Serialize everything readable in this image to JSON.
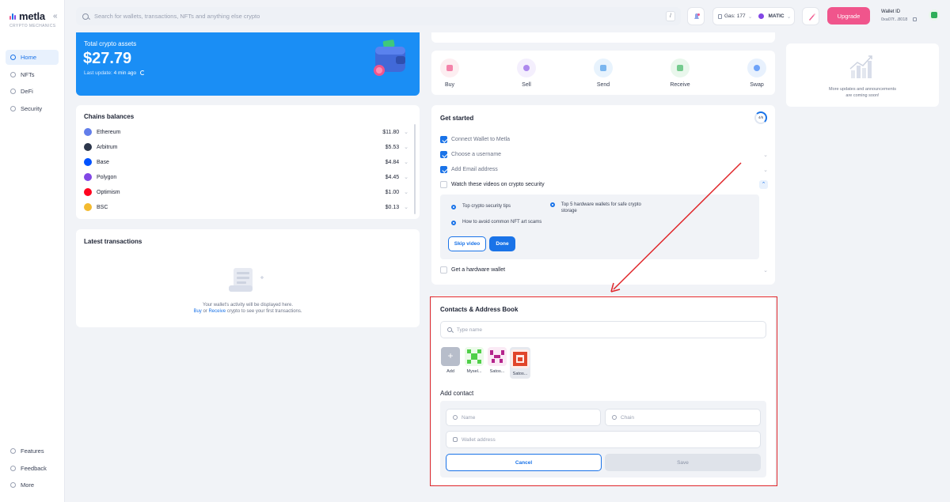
{
  "brand": {
    "name": "metla",
    "tagline": "CRYPTO MECHANICS",
    "collapse_glyph": "«"
  },
  "nav": {
    "items": [
      {
        "label": "Home",
        "active": true
      },
      {
        "label": "NFTs"
      },
      {
        "label": "DeFi"
      },
      {
        "label": "Security"
      }
    ],
    "bottom": [
      {
        "label": "Features"
      },
      {
        "label": "Feedback"
      },
      {
        "label": "More"
      }
    ]
  },
  "header": {
    "search_placeholder": "Search for wallets, transactions, NFTs and anything else crypto",
    "slash": "/",
    "gas_label": "Gas:",
    "gas_value": "177",
    "network": "MATIC",
    "upgrade": "Upgrade",
    "wallet_label": "Wallet ID",
    "wallet_value": "0xa07f...8018"
  },
  "assets": {
    "title": "Total crypto assets",
    "value": "$27.79",
    "update_label": "Last update:",
    "update_time": "4 min ago"
  },
  "chains": {
    "title": "Chains balances",
    "rows": [
      {
        "name": "Ethereum",
        "value": "$11.80",
        "color": "#627eea"
      },
      {
        "name": "Arbitrum",
        "value": "$5.53",
        "color": "#2d374b"
      },
      {
        "name": "Base",
        "value": "$4.84",
        "color": "#0052ff"
      },
      {
        "name": "Polygon",
        "value": "$4.45",
        "color": "#8247e5"
      },
      {
        "name": "Optimism",
        "value": "$1.00",
        "color": "#ff0420"
      },
      {
        "name": "BSC",
        "value": "$0.13",
        "color": "#f3ba2f"
      }
    ]
  },
  "transactions": {
    "title": "Latest transactions",
    "msg1": "Your wallet's activity will be displayed here.",
    "buy": "Buy",
    "or": "or",
    "receive": "Receive",
    "msg2_tail": "crypto to see your first transactions."
  },
  "actions": [
    {
      "label": "Buy",
      "bg": "#fdeef1",
      "fg": "#f0558c"
    },
    {
      "label": "Sell",
      "bg": "#f4effd",
      "fg": "#8e5ce6"
    },
    {
      "label": "Send",
      "bg": "#e8f3fd",
      "fg": "#4b9be8"
    },
    {
      "label": "Receive",
      "bg": "#e9f7ec",
      "fg": "#43b866"
    },
    {
      "label": "Swap",
      "bg": "#e8f1fd",
      "fg": "#3b82f6"
    }
  ],
  "get_started": {
    "title": "Get started",
    "progress": "4/6",
    "tasks": [
      {
        "label": "Connect Wallet to Metla",
        "done": true
      },
      {
        "label": "Choose a username",
        "done": true
      },
      {
        "label": "Add Email address",
        "done": true
      },
      {
        "label": "Watch these videos on crypto security",
        "done": false
      },
      {
        "label": "Get a hardware wallet",
        "done": false
      }
    ],
    "videos": [
      "Top crypto security tips",
      "Top 5 hardware wallets for safe crypto storage",
      "How to avoid common NFT art scams"
    ],
    "skip": "Skip video",
    "done": "Done"
  },
  "contacts": {
    "title": "Contacts & Address Book",
    "search_placeholder": "Type name",
    "avatars": [
      {
        "label": "Add"
      },
      {
        "label": "Mysel...",
        "color": "#4fcf48"
      },
      {
        "label": "Satos...",
        "color": "#b4248c"
      },
      {
        "label": "Satos...",
        "color": "#e0452a"
      }
    ],
    "add_title": "Add contact",
    "name_placeholder": "Name",
    "chain_placeholder": "Chain",
    "address_placeholder": "Wallet address",
    "cancel": "Cancel",
    "save": "Save"
  },
  "news": {
    "line1": "More updates and announcements",
    "line2": "are coming soon!"
  },
  "colors": {
    "accent": "#1a73e8",
    "brand_pink": "#f0558c",
    "highlight_red": "#e0262a"
  }
}
